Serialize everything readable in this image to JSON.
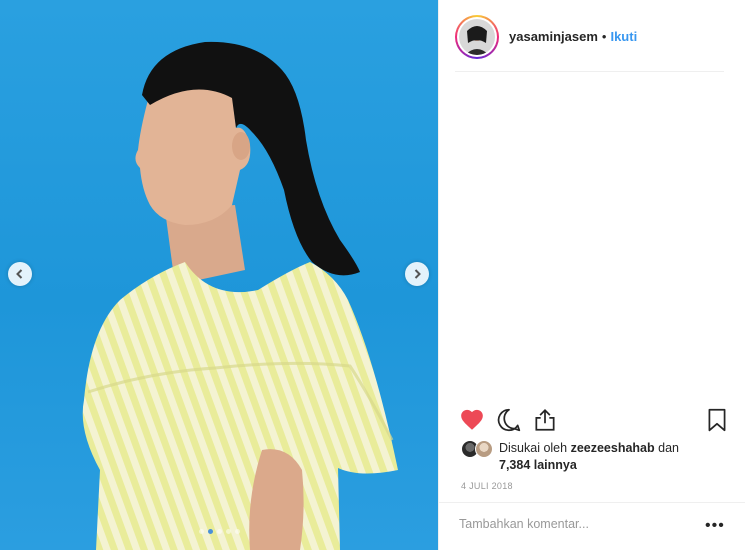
{
  "post": {
    "username": "yasaminjasem",
    "separator": "•",
    "follow_label": "Ikuti",
    "liked_by_prefix": "Disukai oleh",
    "liked_by_user": "zeezeeshahab",
    "liked_by_and": "dan",
    "others_count": "7,384 lainnya",
    "date": "4 JULI 2018",
    "comment_placeholder": "Tambahkan komentar...",
    "more_label": "•••",
    "liked": true
  },
  "carousel": {
    "slide_count": 5,
    "active_slide": 2
  },
  "icons": {
    "prev": "chevron-left-icon",
    "next": "chevron-right-icon",
    "like": "heart-icon",
    "comment": "comment-icon",
    "share": "share-icon",
    "save": "bookmark-icon"
  },
  "colors": {
    "background_blue": "#1e96d9",
    "like_red": "#ed4956",
    "link_blue": "#3897f0",
    "blouse_yellow": "#eef0a8"
  }
}
